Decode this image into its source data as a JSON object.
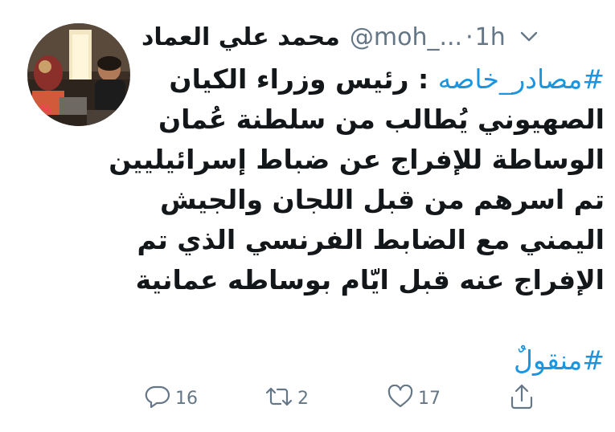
{
  "tweet": {
    "author": {
      "display_name": "محمد علي العماد",
      "handle": "@moh_...",
      "avatar": "avatar-photo"
    },
    "separator": "·",
    "time": "1h",
    "menu_icon": "chevron-down-icon",
    "body_lines": [
      {
        "hashtag": "#مصادر_خاصه",
        "text": " : رئيس وزراء الكيان"
      },
      {
        "text": "الصهيوني يُطالب من سلطنة عُمان"
      },
      {
        "text": "الوساطة للإفراج عن ضباط إسرائيليين"
      },
      {
        "text": "تم اسرهم من قبل اللجان والجيش"
      },
      {
        "text": "اليمني مع الضابط الفرنسي الذي تم"
      },
      {
        "text": "الإفراج عنه قبل ايّام بوساطه عمانية"
      }
    ],
    "footer_hashtag": "#منقولٌ",
    "actions": {
      "reply": {
        "icon": "reply-icon",
        "count": "16"
      },
      "retweet": {
        "icon": "retweet-icon",
        "count": "2"
      },
      "like": {
        "icon": "heart-icon",
        "count": "17"
      },
      "share": {
        "icon": "share-icon"
      }
    },
    "colors": {
      "text": "#14171a",
      "secondary": "#657786",
      "link": "#1b95e0"
    }
  }
}
